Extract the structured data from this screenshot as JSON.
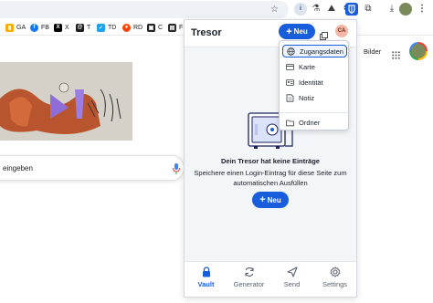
{
  "browser": {
    "bookmarks": [
      {
        "label": "GA",
        "color": "#f9ab00"
      },
      {
        "label": "FB",
        "color": "#1877f2"
      },
      {
        "label": "X",
        "color": "#000000"
      },
      {
        "label": "T",
        "color": "#1c1c1c"
      },
      {
        "label": "TD",
        "color": "#1da1f2"
      },
      {
        "label": "RD",
        "color": "#ff4500"
      },
      {
        "label": "C",
        "color": "#222222"
      },
      {
        "label": "F",
        "color": "#2b2b2b"
      }
    ],
    "toolbar_icons": [
      "star-icon",
      "extension-1-icon",
      "extension-2-icon",
      "extension-3-icon",
      "bitwarden-extension-icon",
      "puzzle-icon",
      "download-icon",
      "profile-icon",
      "menu-icon"
    ]
  },
  "page": {
    "search_text": "eingeben",
    "bilder_link": "Bilder"
  },
  "popup": {
    "title": "Tresor",
    "new_label": "Neu",
    "account_initials": "CA",
    "empty_title": "Dein Tresor hat keine Einträge",
    "empty_desc": "Speichere einen Login-Eintrag für diese Seite zum automatischen Ausfüllen",
    "new_label_2": "Neu",
    "nav": [
      {
        "label": "Vault",
        "icon": "lock-icon",
        "active": true
      },
      {
        "label": "Generator",
        "icon": "refresh-icon",
        "active": false
      },
      {
        "label": "Send",
        "icon": "send-icon",
        "active": false
      },
      {
        "label": "Settings",
        "icon": "gear-icon",
        "active": false
      }
    ],
    "accent": "#175ddc"
  },
  "menu": {
    "items": [
      {
        "label": "Zugangsdaten",
        "icon": "globe-icon"
      },
      {
        "label": "Karte",
        "icon": "card-icon"
      },
      {
        "label": "Identität",
        "icon": "id-card-icon"
      },
      {
        "label": "Notiz",
        "icon": "note-icon"
      },
      {
        "label": "Ordner",
        "icon": "folder-icon"
      }
    ]
  }
}
